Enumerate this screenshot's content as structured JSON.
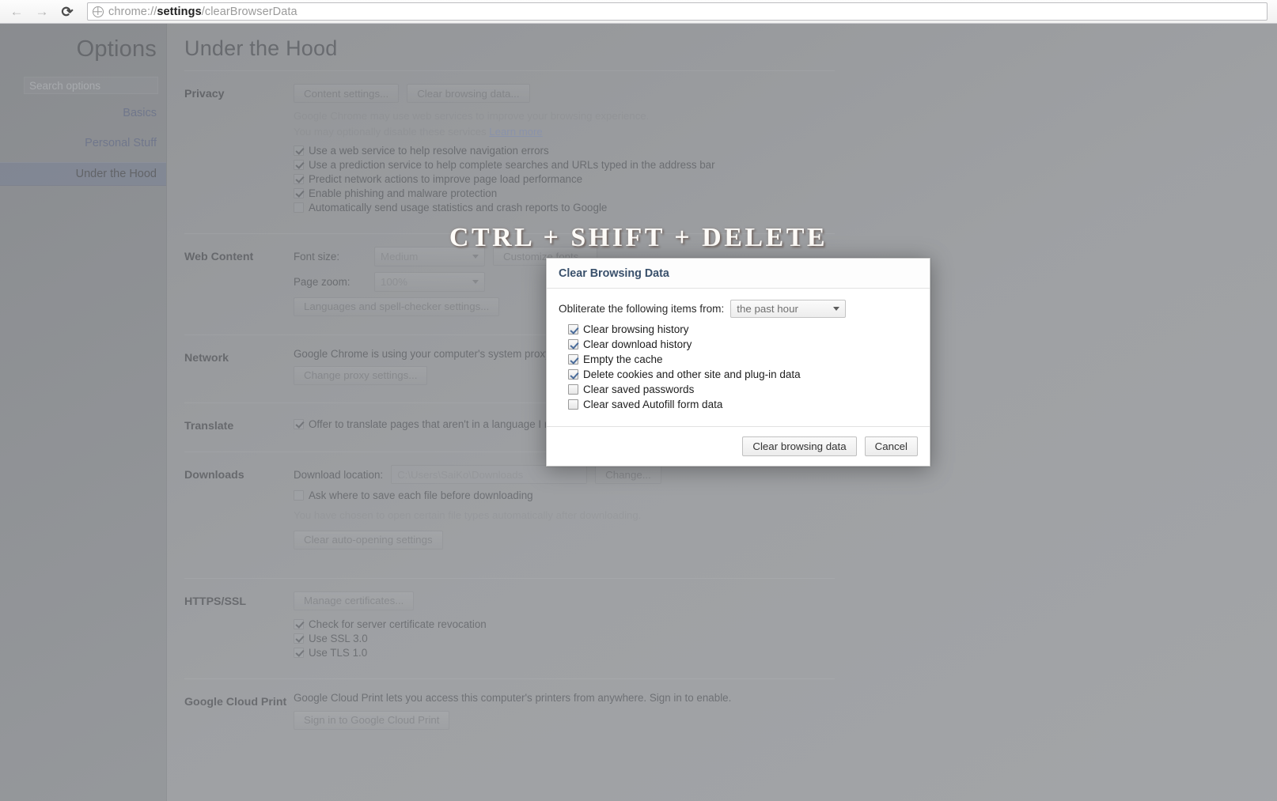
{
  "browser": {
    "back_icon": "back-arrow-icon",
    "forward_icon": "forward-arrow-icon",
    "reload_icon": "reload-icon",
    "url_prefix": "chrome://",
    "url_bold": "settings",
    "url_suffix": "/clearBrowserData"
  },
  "sidebar": {
    "title": "Options",
    "search_placeholder": "Search options",
    "items": [
      {
        "label": "Basics",
        "selected": false
      },
      {
        "label": "Personal Stuff",
        "selected": false
      },
      {
        "label": "Under the Hood",
        "selected": true
      }
    ]
  },
  "page": {
    "title": "Under the Hood",
    "sections": {
      "privacy": {
        "label": "Privacy",
        "content_settings_btn": "Content settings...",
        "clear_browsing_btn": "Clear browsing data...",
        "desc_line1": "Google Chrome may use web services to improve your browsing experience.",
        "desc_line2": "You may optionally disable these services",
        "learn_more": "Learn more",
        "checkboxes": [
          {
            "label": "Use a web service to help resolve navigation errors",
            "checked": true
          },
          {
            "label": "Use a prediction service to help complete searches and URLs typed in the address bar",
            "checked": true
          },
          {
            "label": "Predict network actions to improve page load performance",
            "checked": true
          },
          {
            "label": "Enable phishing and malware protection",
            "checked": true
          },
          {
            "label": "Automatically send usage statistics and crash reports to Google",
            "checked": false
          }
        ]
      },
      "web_content": {
        "label": "Web Content",
        "font_size_label": "Font size:",
        "font_size_value": "Medium",
        "customize_btn": "Customize fonts...",
        "page_zoom_label": "Page zoom:",
        "page_zoom_value": "100%",
        "languages_btn": "Languages and spell-checker settings..."
      },
      "network": {
        "label": "Network",
        "desc": "Google Chrome is using your computer's system proxy settings to connect to the network.",
        "proxy_btn": "Change proxy settings..."
      },
      "translate": {
        "label": "Translate",
        "checkbox": {
          "label": "Offer to translate pages that aren't in a language I read",
          "checked": true
        }
      },
      "downloads": {
        "label": "Downloads",
        "location_label": "Download location:",
        "location_value": "C:\\Users\\SaiKo\\Downloads",
        "change_btn": "Change...",
        "ask_checkbox": {
          "label": "Ask where to save each file before downloading",
          "checked": false
        },
        "auto_open_text": "You have chosen to open certain file types automatically after downloading.",
        "clear_auto_btn": "Clear auto-opening settings"
      },
      "https_ssl": {
        "label": "HTTPS/SSL",
        "manage_btn": "Manage certificates...",
        "checkboxes": [
          {
            "label": "Check for server certificate revocation",
            "checked": true
          },
          {
            "label": "Use SSL 3.0",
            "checked": true
          },
          {
            "label": "Use TLS 1.0",
            "checked": true
          }
        ]
      },
      "cloud_print": {
        "label": "Google Cloud Print",
        "desc": "Google Cloud Print lets you access this computer's printers from anywhere. Sign in to enable.",
        "signin_btn": "Sign in to Google Cloud Print"
      }
    }
  },
  "hint_overlay": {
    "text": "CTRL + SHIFT + DELETE"
  },
  "dialog": {
    "title": "Clear Browsing Data",
    "period_label": "Obliterate the following items from:",
    "period_value": "the past hour",
    "checkboxes": [
      {
        "label": "Clear browsing history",
        "checked": true
      },
      {
        "label": "Clear download history",
        "checked": true
      },
      {
        "label": "Empty the cache",
        "checked": true
      },
      {
        "label": "Delete cookies and other site and plug-in data",
        "checked": true
      },
      {
        "label": "Clear saved passwords",
        "checked": false
      },
      {
        "label": "Clear saved Autofill form data",
        "checked": false
      }
    ],
    "confirm_btn": "Clear browsing data",
    "cancel_btn": "Cancel"
  },
  "colors": {
    "accent": "#39506b",
    "link": "#6f7fae",
    "sidebar_bg": "#7a7d81",
    "selected_bg": "#636d85"
  }
}
